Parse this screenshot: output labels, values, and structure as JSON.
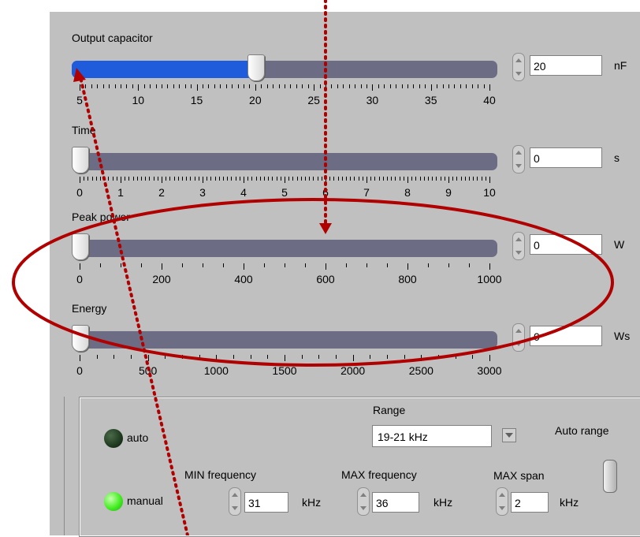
{
  "sliders": [
    {
      "label": "Output capacitor",
      "value": "20",
      "unit": "nF",
      "min": 5,
      "max": 40,
      "level": 20,
      "tick_labels": [
        "5",
        "10",
        "15",
        "20",
        "25",
        "30",
        "35",
        "40"
      ]
    },
    {
      "label": "Time",
      "value": "0",
      "unit": "s",
      "min": 0,
      "max": 10,
      "level": 0,
      "tick_labels": [
        "0",
        "1",
        "2",
        "3",
        "4",
        "5",
        "6",
        "7",
        "8",
        "9",
        "10"
      ]
    },
    {
      "label": "Peak power",
      "value": "0",
      "unit": "W",
      "min": 0,
      "max": 1000,
      "level": 0,
      "tick_labels": [
        "0",
        "200",
        "400",
        "600",
        "800",
        "1000"
      ]
    },
    {
      "label": "Energy",
      "value": "0",
      "unit": "Ws",
      "min": 0,
      "max": 3000,
      "level": 0,
      "tick_labels": [
        "0",
        "500",
        "1000",
        "1500",
        "2000",
        "2500",
        "3000"
      ]
    }
  ],
  "frequency_panel": {
    "range_label": "Range",
    "range_value": "19-21 kHz",
    "auto_range_label": "Auto range",
    "auto_label": "auto",
    "manual_label": "manual",
    "min_freq_label": "MIN frequency",
    "min_freq_value": "31",
    "min_freq_unit": "kHz",
    "max_freq_label": "MAX frequency",
    "max_freq_value": "36",
    "max_freq_unit": "kHz",
    "max_span_label": "MAX span",
    "max_span_value": "2",
    "max_span_unit": "kHz"
  },
  "colors": {
    "panel": "#c0c0c0",
    "slider_fill": "#1e5cdc",
    "slider_track": "#6c6c84",
    "annotation_red": "#b00000",
    "led_auto": "#1f3a1f",
    "led_manual": "#44ee22"
  }
}
